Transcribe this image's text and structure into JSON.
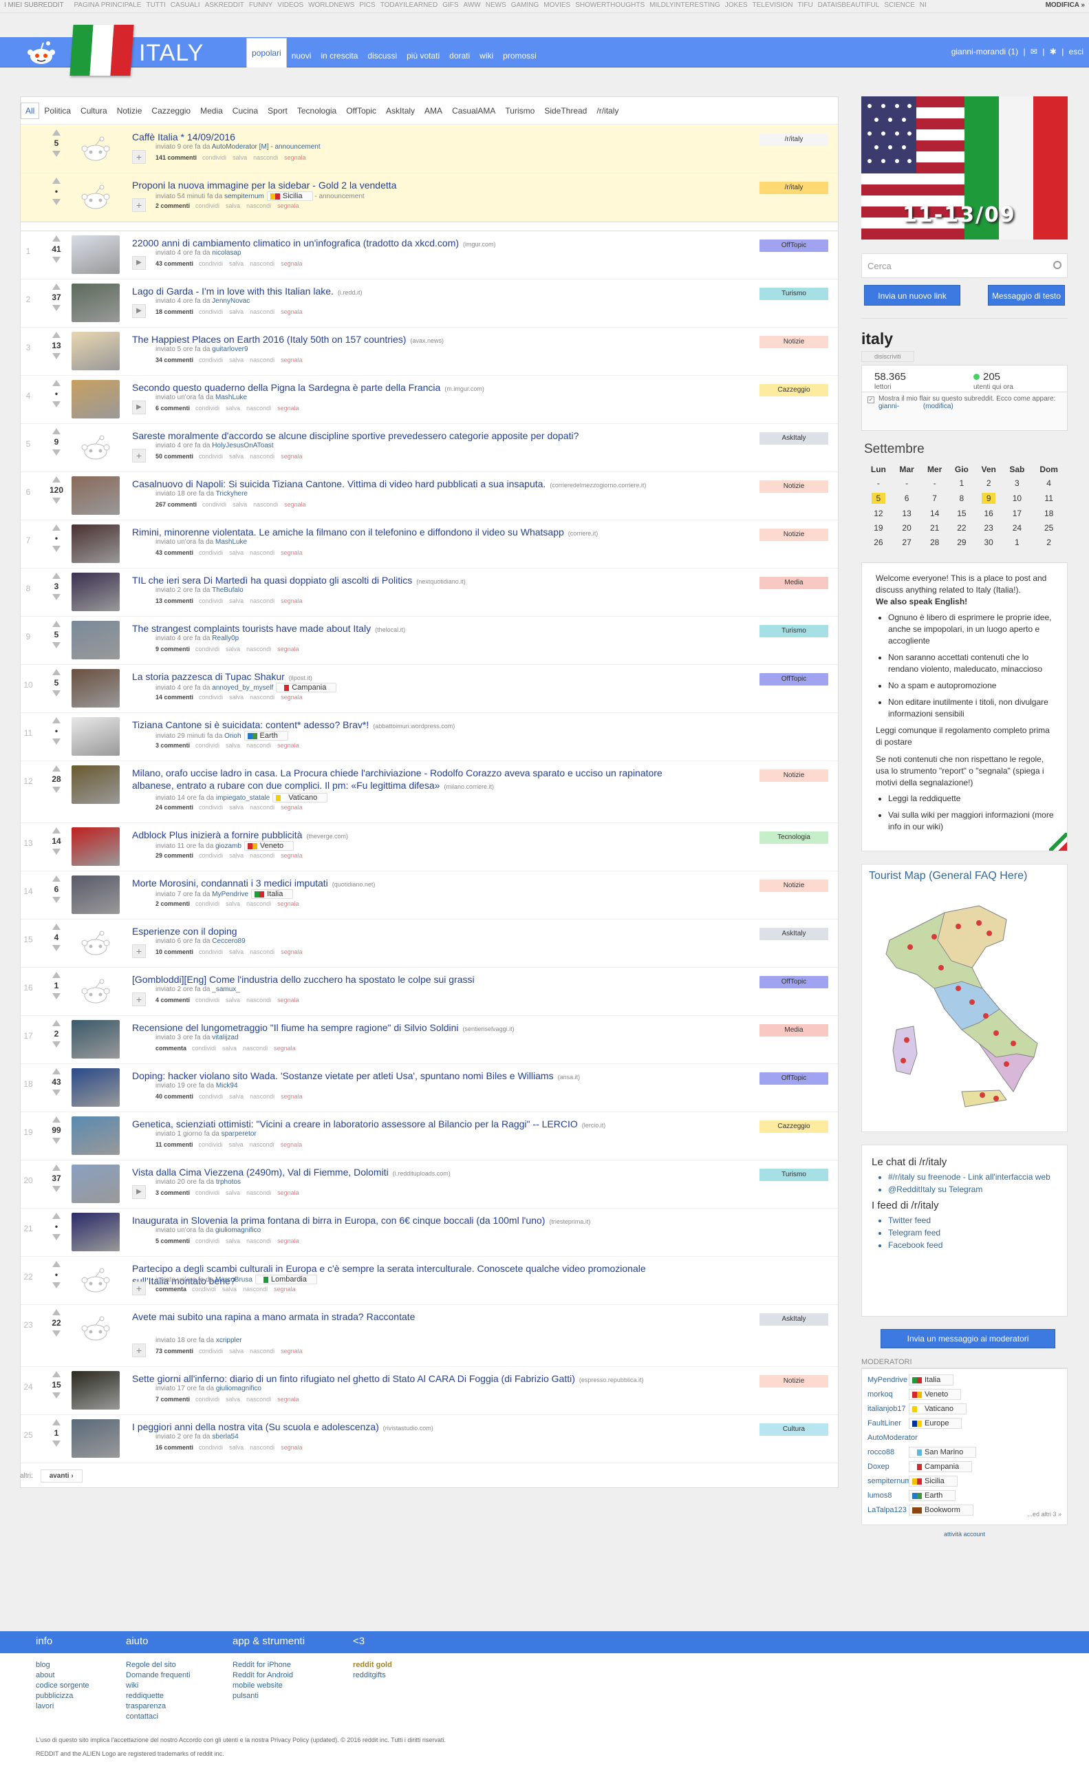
{
  "topbar": {
    "mysubs": "I MIEI SUBREDDIT",
    "items": [
      "pagina principale",
      "tutti",
      "casuali",
      "askreddit",
      "funny",
      "videos",
      "worldnews",
      "pics",
      "todayilearned",
      "gifs",
      "aww",
      "news",
      "gaming",
      "movies",
      "showerthoughts",
      "mildlyinteresting",
      "jokes",
      "television",
      "tifu",
      "dataisbeautiful",
      "science",
      "ni"
    ],
    "edit": "MODIFICA »"
  },
  "header": {
    "subreddit": "ITALY",
    "tabs": [
      "popolari",
      "nuovi",
      "in crescita",
      "discussi",
      "più votati",
      "dorati",
      "wiki",
      "promossi"
    ],
    "user": "gianni-morandi (1)",
    "logout": "esci"
  },
  "categories": [
    "All",
    "Politica",
    "Cultura",
    "Notizie",
    "Cazzeggio",
    "Media",
    "Cucina",
    "Sport",
    "Tecnologia",
    "OffTopic",
    "AskItaly",
    "AMA",
    "CasualAMA",
    "Turismo",
    "SideThread",
    "/r/italy"
  ],
  "labels": {
    "share": "condividi",
    "save": "salva",
    "hide": "nascondi",
    "report": "segnala"
  },
  "sticky": [
    {
      "score": "5",
      "title": "Caffè Italia * 14/09/2016",
      "tagline": "inviato 9 ore fa da",
      "user": "AutoModerator",
      "extra": "[M] - announcement",
      "comments": "141 commenti",
      "flair": "/r/italy"
    },
    {
      "score": "•",
      "title": "Proponi la nuova immagine per la sidebar - Gold 2 la vendetta",
      "tagline": "inviato 54 minuti fa da",
      "user": "sempiternum",
      "uflair": "Sicilia",
      "extra": "- announcement",
      "comments": "2 commenti",
      "flair": "/r/italy"
    }
  ],
  "posts": [
    {
      "rank": "1",
      "score": "41",
      "title": "22000 anni di cambiamento climatico in un'infografica (tradotto da xkcd.com)",
      "domain": "(imgur.com)",
      "tagline": "inviato 4 ore fa da",
      "user": "nicolasap",
      "comments": "43 commenti",
      "flair": "OffTopic",
      "flairColor": "#9fa3f0",
      "exp": "play"
    },
    {
      "rank": "2",
      "score": "37",
      "title": "Lago di Garda - I'm in love with this Italian lake.",
      "domain": "(i.redd.it)",
      "tagline": "inviato 4 ore fa da",
      "user": "JennyNovac",
      "comments": "18 commenti",
      "flair": "Turismo",
      "flairColor": "#a4e0e4",
      "exp": "play"
    },
    {
      "rank": "3",
      "score": "13",
      "title": "The Happiest Places on Earth 2016 (Italy 50th on 157 countries)",
      "domain": "(avax.news)",
      "tagline": "inviato 5 ore fa da",
      "user": "guitarlover9",
      "comments": "34 commenti",
      "flair": "Notizie",
      "flairColor": "#fddad0",
      "exp": ""
    },
    {
      "rank": "4",
      "score": "•",
      "title": "Secondo questo quaderno della Pigna la Sardegna è parte della Francia",
      "domain": "(m.imgur.com)",
      "tagline": "inviato un'ora fa da",
      "user": "MashLuke",
      "comments": "6 commenti",
      "flair": "Cazzeggio",
      "flairColor": "#fdeca0",
      "exp": "play"
    },
    {
      "rank": "5",
      "score": "9",
      "title": "Sareste moralmente d'accordo se alcune discipline sportive prevedessero categorie apposite per dopati?",
      "domain": "",
      "tagline": "inviato 4 ore fa da",
      "user": "HolyJesusOnAToast",
      "comments": "50 commenti",
      "flair": "AskItaly",
      "flairColor": "#dde0e6",
      "exp": "plus"
    },
    {
      "rank": "6",
      "score": "120",
      "title": "Casalnuovo di Napoli: Si suicida Tiziana Cantone. Vittima di video hard pubblicati a sua insaputa.",
      "domain": "(corrieredelmezzogiorno.corriere.it)",
      "tagline": "inviato 18 ore fa da",
      "user": "Trickyhere",
      "comments": "267 commenti",
      "flair": "Notizie",
      "flairColor": "#fddad0",
      "exp": ""
    },
    {
      "rank": "7",
      "score": "•",
      "title": "Rimini, minorenne violentata. Le amiche la filmano con il telefonino e diffondono il video su Whatsapp",
      "domain": "(corriere.it)",
      "tagline": "inviato un'ora fa da",
      "user": "MashLuke",
      "comments": "43 commenti",
      "flair": "Notizie",
      "flairColor": "#fddad0",
      "exp": ""
    },
    {
      "rank": "8",
      "score": "3",
      "title": "TIL che ieri sera Di Martedì ha quasi doppiato gli ascolti di Politics",
      "domain": "(nextquotidiano.it)",
      "tagline": "inviato 2 ore fa da",
      "user": "TheBufalo",
      "comments": "13 commenti",
      "flair": "Media",
      "flairColor": "#f8c9c2",
      "exp": ""
    },
    {
      "rank": "9",
      "score": "5",
      "title": "The strangest complaints tourists have made about Italy",
      "domain": "(thelocal.it)",
      "tagline": "inviato 4 ore fa da",
      "user": "Really0p",
      "comments": "9 commenti",
      "flair": "Turismo",
      "flairColor": "#a4e0e4",
      "exp": ""
    },
    {
      "rank": "10",
      "score": "5",
      "title": "La storia pazzesca di Tupac Shakur",
      "domain": "(ilpost.it)",
      "tagline": "inviato 4 ore fa da",
      "user": "annoyed_by_myself",
      "uflair": "Campania",
      "comments": "14 commenti",
      "flair": "OffTopic",
      "flairColor": "#9fa3f0",
      "exp": ""
    },
    {
      "rank": "11",
      "score": "•",
      "title": "Tiziana Cantone si è suicidata: content* adesso? Brav*!",
      "domain": "(abbattoimuri.wordpress.com)",
      "tagline": "inviato 29 minuti fa da",
      "user": "Orioh",
      "uflair": "Earth",
      "comments": "3 commenti",
      "flair": "",
      "flairColor": "",
      "exp": ""
    },
    {
      "rank": "12",
      "score": "28",
      "title": "Milano, orafo uccise ladro in casa. La Procura chiede l'archiviazione - Rodolfo Corazzo aveva sparato e ucciso un rapinatore albanese, entrato a rubare con due complici. Il pm: «Fu legittima difesa»",
      "domain": "(milano.corriere.it)",
      "tagline": "inviato 14 ore fa da",
      "user": "impiegato_statale",
      "uflair": "Vaticano",
      "comments": "24 commenti",
      "flair": "Notizie",
      "flairColor": "#fddad0",
      "exp": ""
    },
    {
      "rank": "13",
      "score": "14",
      "title": "Adblock Plus inizierà a fornire pubblicità",
      "domain": "(theverge.com)",
      "tagline": "inviato 11 ore fa da",
      "user": "giozamb",
      "uflair": "Veneto",
      "comments": "29 commenti",
      "flair": "Tecnologia",
      "flairColor": "#c6eec8",
      "exp": ""
    },
    {
      "rank": "14",
      "score": "6",
      "title": "Morte Morosini, condannati i 3 medici imputati",
      "domain": "(quotidiano.net)",
      "tagline": "inviato 7 ore fa da",
      "user": "MyPendrive",
      "uflair": "Italia",
      "comments": "2 commenti",
      "flair": "Notizie",
      "flairColor": "#fddad0",
      "exp": ""
    },
    {
      "rank": "15",
      "score": "4",
      "title": "Esperienze con il doping",
      "domain": "",
      "tagline": "inviato 6 ore fa da",
      "user": "Ceccero89",
      "comments": "10 commenti",
      "flair": "AskItaly",
      "flairColor": "#dde0e6",
      "exp": "plus"
    },
    {
      "rank": "16",
      "score": "1",
      "title": "[Gombloddi][Eng] Come l'industria dello zucchero ha spostato le colpe sui grassi",
      "domain": "",
      "tagline": "inviato 2 ore fa da",
      "user": "_samux_",
      "comments": "4 commenti",
      "flair": "OffTopic",
      "flairColor": "#9fa3f0",
      "exp": "plus"
    },
    {
      "rank": "17",
      "score": "2",
      "title": "Recensione del lungometraggio \"Il fiume ha sempre ragione\" di Silvio Soldini",
      "domain": "(sentieriselvaggi.it)",
      "tagline": "inviato 3 ore fa da",
      "user": "vitalijzad",
      "comments": "commenta",
      "flair": "Media",
      "flairColor": "#f8c9c2",
      "exp": ""
    },
    {
      "rank": "18",
      "score": "43",
      "title": "Doping: hacker violano sito Wada. 'Sostanze vietate per atleti Usa', spuntano nomi Biles e Williams",
      "domain": "(ansa.it)",
      "tagline": "inviato 19 ore fa da",
      "user": "Mick94",
      "comments": "40 commenti",
      "flair": "OffTopic",
      "flairColor": "#9fa3f0",
      "exp": ""
    },
    {
      "rank": "19",
      "score": "99",
      "title": "Genetica, scienziati ottimisti: \"Vicini a creare in laboratorio assessore al Bilancio per la Raggi\" -- LERCIO",
      "domain": "(lercio.it)",
      "tagline": "inviato 1 giorno fa da",
      "user": "sparperetor",
      "comments": "11 commenti",
      "flair": "Cazzeggio",
      "flairColor": "#fdeca0",
      "exp": ""
    },
    {
      "rank": "20",
      "score": "37",
      "title": "Vista dalla Cima Viezzena (2490m), Val di Fiemme, Dolomiti",
      "domain": "(i.reddituploads.com)",
      "tagline": "inviato 20 ore fa da",
      "user": "trphotos",
      "comments": "3 commenti",
      "flair": "Turismo",
      "flairColor": "#a4e0e4",
      "exp": "play"
    },
    {
      "rank": "21",
      "score": "•",
      "title": "Inaugurata in Slovenia la prima fontana di birra in Europa, con 6€ cinque boccali (da 100ml l'uno)",
      "domain": "(triesteprima.it)",
      "tagline": "inviato un'ora fa da",
      "user": "giuliomagnifico",
      "comments": "5 commenti",
      "flair": "",
      "flairColor": "",
      "exp": ""
    },
    {
      "rank": "22",
      "score": "•",
      "title": "Partecipo a degli scambi culturali in Europa e c'è sempre la serata interculturale. Conoscete qualche video promozionale sull'Italia montato bene?",
      "domain": "",
      "tagline": "inviato un'ora fa da",
      "user": "MarcoBrusa",
      "uflair": "Lombardia",
      "comments": "commenta",
      "flair": "",
      "flairColor": "",
      "exp": "plus"
    },
    {
      "rank": "23",
      "score": "22",
      "title": "Avete mai subito una rapina a mano armata in strada? Raccontate",
      "domain": "",
      "tagline": "inviato 18 ore fa da",
      "user": "xcrippler",
      "comments": "73 commenti",
      "flair": "AskItaly",
      "flairColor": "#dde0e6",
      "exp": "plus"
    },
    {
      "rank": "24",
      "score": "15",
      "title": "Sette giorni all'inferno: diario di un finto rifugiato nel ghetto di Stato Al CARA Di Foggia (di Fabrizio Gatti)",
      "domain": "(espresso.repubblica.it)",
      "tagline": "inviato 17 ore fa da",
      "user": "giuliomagnifico",
      "comments": "7 commenti",
      "flair": "Notizie",
      "flairColor": "#fddad0",
      "exp": ""
    },
    {
      "rank": "25",
      "score": "1",
      "title": "I peggiori anni della nostra vita (Su scuola e adolescenza)",
      "domain": "(rivistastudio.com)",
      "tagline": "inviato 2 ore fa da",
      "user": "sberla54",
      "comments": "16 commenti",
      "flair": "Cultura",
      "flairColor": "#b8e6f0",
      "exp": ""
    }
  ],
  "nav": {
    "label": "altri:",
    "next": "avanti ›"
  },
  "sidebar": {
    "banner_text": "11-13/09",
    "search_placeholder": "Cerca",
    "submit_link": "Invia un nuovo link",
    "submit_text": "Messaggio di testo",
    "title": "italy",
    "unsubscribe": "disiscriviti",
    "readers": "58.365",
    "readers_label": "lettori",
    "online": "205",
    "online_label": "utenti qui ora",
    "flair_opt": "Mostra il mio flair su questo subreddit. Ecco come appare:",
    "flair_user": "gianni-",
    "flair_edit": "(modifica)",
    "calendar_title": "Settembre",
    "cal_days": [
      "Lun",
      "Mar",
      "Mer",
      "Gio",
      "Ven",
      "Sab",
      "Dom"
    ],
    "cal_rows": [
      [
        "-",
        "-",
        "-",
        "1",
        "2",
        "3",
        "4"
      ],
      [
        "5",
        "6",
        "7",
        "8",
        "9",
        "10",
        "11"
      ],
      [
        "12",
        "13",
        "14",
        "15",
        "16",
        "17",
        "18"
      ],
      [
        "19",
        "20",
        "21",
        "22",
        "23",
        "24",
        "25"
      ],
      [
        "26",
        "27",
        "28",
        "29",
        "30",
        "1",
        "2"
      ]
    ],
    "rules_intro": "Welcome everyone! This is a place to post and discuss anything related to Italy (Italia!).",
    "rules_en": "We also speak English!",
    "rules": [
      "Ognuno è libero di esprimere le proprie idee, anche se impopolari, in un luogo aperto e accogliente",
      "Non saranno accettati contenuti che lo rendano violento, maleducato, minaccioso",
      "No a spam e autopromozione",
      "Non editare inutilmente i titoli, non divulgare informazioni sensibili"
    ],
    "rules_read": "Leggi comunque il regolamento completo prima di postare",
    "rules_report": "Se noti contenuti che non rispettano le regole, usa lo strumento \"report\" o \"segnala\" (spiega i motivi della segnalazione!)",
    "rules_links": [
      "Leggi la reddiquette",
      "Vai sulla wiki per maggiori informazioni (more info in our wiki)"
    ],
    "map_title": "Tourist Map (General FAQ Here)",
    "chat_title": "Le chat di /r/italy",
    "chat_links": [
      "#/r/italy su freenode - Link all'interfaccia web",
      "@RedditItaly su Telegram"
    ],
    "feed_title": "I feed di /r/italy",
    "feed_links": [
      "Twitter feed",
      "Telegram feed",
      "Facebook feed"
    ],
    "mod_message": "Invia un messaggio ai moderatori",
    "mods_title": "MODERATORI",
    "mods": [
      {
        "user": "MyPendrive",
        "flair": "Italia"
      },
      {
        "user": "morkoq",
        "flair": "Veneto"
      },
      {
        "user": "italianjob17",
        "flair": "Vaticano"
      },
      {
        "user": "FaultLiner",
        "flair": "Europe"
      },
      {
        "user": "AutoModerator",
        "flair": ""
      },
      {
        "user": "rocco88",
        "flair": "San Marino"
      },
      {
        "user": "Doxep",
        "flair": "Campania"
      },
      {
        "user": "sempiternum",
        "flair": "Sicilia"
      },
      {
        "user": "lumos8",
        "flair": "Earth"
      },
      {
        "user": "LaTalpa123",
        "flair": "Bookworm"
      }
    ],
    "mods_more": "...ed altri 3 »",
    "mods_activity": "attività account"
  },
  "footer": {
    "cols": [
      {
        "title": "info",
        "links": [
          "blog",
          "about",
          "codice sorgente",
          "pubblicizza",
          "lavori"
        ]
      },
      {
        "title": "aiuto",
        "links": [
          "Regole del sito",
          "Domande frequenti",
          "wiki",
          "reddiquette",
          "trasparenza",
          "contattaci"
        ]
      },
      {
        "title": "app & strumenti",
        "links": [
          "Reddit for iPhone",
          "Reddit for Android",
          "mobile website",
          "pulsanti"
        ]
      },
      {
        "title": "<3",
        "links": [
          "reddit gold",
          "redditgifts"
        ]
      }
    ],
    "copyright": "L'uso di questo sito implica l'accettazione del nostro Accordo con gli utenti e la nostra Privacy Policy (updated). © 2016 reddit inc. Tutti i diritti riservati.",
    "trademark": "REDDIT and the ALIEN Logo are registered trademarks of reddit inc."
  }
}
